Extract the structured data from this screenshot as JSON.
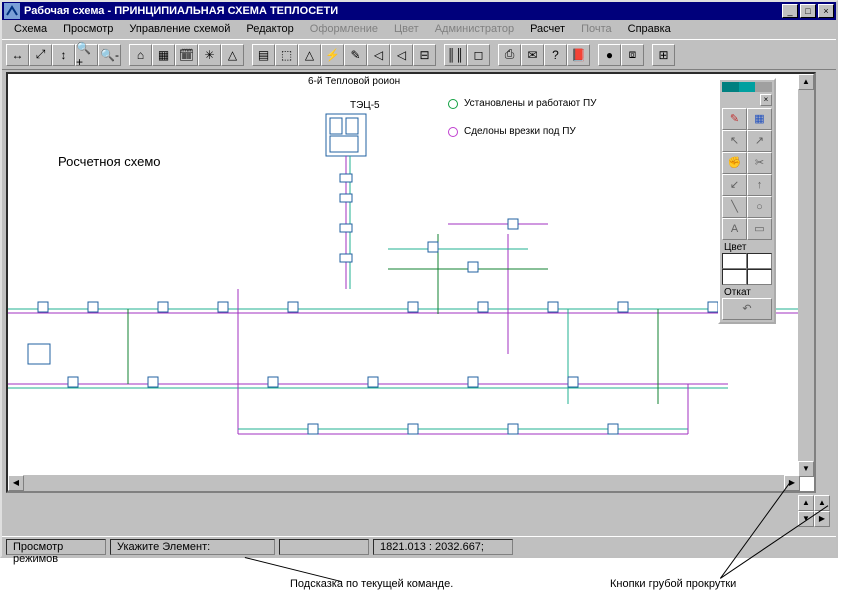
{
  "window": {
    "title": "Рабочая схема - ПРИНЦИПИАЛЬНАЯ СХЕМА ТЕПЛОСЕТИ"
  },
  "menu": {
    "items": [
      {
        "label": "Схема",
        "enabled": true
      },
      {
        "label": "Просмотр",
        "enabled": true
      },
      {
        "label": "Управление схемой",
        "enabled": true
      },
      {
        "label": "Редактор",
        "enabled": true
      },
      {
        "label": "Оформление",
        "enabled": false
      },
      {
        "label": "Цвет",
        "enabled": false
      },
      {
        "label": "Администратор",
        "enabled": false
      },
      {
        "label": "Расчет",
        "enabled": true
      },
      {
        "label": "Почта",
        "enabled": false
      },
      {
        "label": "Справка",
        "enabled": true
      }
    ]
  },
  "toolbar_groups": [
    [
      "↔",
      "⤢",
      "↕",
      "🔍+",
      "🔍-"
    ],
    [
      "⌂",
      "▦",
      "🗓",
      "✳",
      "△"
    ],
    [
      "▤",
      "⬚",
      "△",
      "⚡",
      "✎",
      "◁",
      "◁",
      "⊟"
    ],
    [
      "║║",
      "◻"
    ],
    [
      "⎙",
      "✉",
      "?",
      "📕"
    ],
    [
      "●",
      "⧈"
    ],
    [
      "⊞"
    ]
  ],
  "canvas": {
    "title": "6-й Тепловой роион",
    "source_label": "ТЭЦ-5",
    "schema_caption": "Росчетноя схемо",
    "legend": [
      {
        "color": "#10a040",
        "text": "Установлены и работают ПУ"
      },
      {
        "color": "#c040d0",
        "text": "Сделоны врезки под ПУ"
      }
    ]
  },
  "palette": {
    "color_label": "Цвет",
    "undo_label": "Откат",
    "undo_glyph": "↶"
  },
  "status": {
    "mode": "Просмотр режимов",
    "prompt": "Укажите Элемент:",
    "coords": "1821.013 : 2032.667;"
  },
  "annotations": {
    "hint": "Подсказка по текущей команде.",
    "coarse": "Кнопки грубой прокрутки"
  }
}
